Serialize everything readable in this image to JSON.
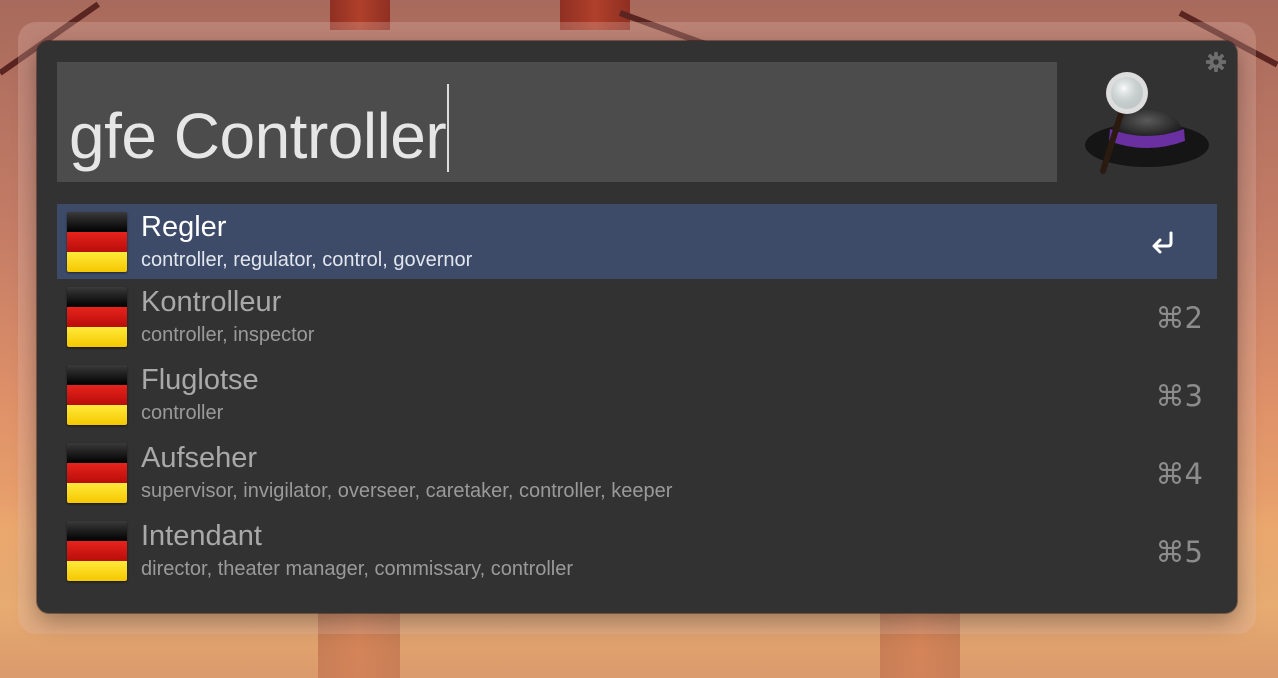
{
  "search": {
    "query": "gfe Controller"
  },
  "results": [
    {
      "title": "Regler",
      "subtitle": "controller, regulator, control, governor",
      "shortcut": "",
      "icon": "german-flag-icon",
      "selected": true
    },
    {
      "title": "Kontrolleur",
      "subtitle": "controller, inspector",
      "shortcut": "⌘2",
      "icon": "german-flag-icon",
      "selected": false
    },
    {
      "title": "Fluglotse",
      "subtitle": "controller",
      "shortcut": "⌘3",
      "icon": "german-flag-icon",
      "selected": false
    },
    {
      "title": "Aufseher",
      "subtitle": "supervisor, invigilator, overseer, caretaker, controller, keeper",
      "shortcut": "⌘4",
      "icon": "german-flag-icon",
      "selected": false
    },
    {
      "title": "Intendant",
      "subtitle": "director, theater manager, commissary, controller",
      "shortcut": "⌘5",
      "icon": "german-flag-icon",
      "selected": false
    }
  ],
  "colors": {
    "window_bg": "#323232",
    "search_bg": "#4c4c4c",
    "selected_row": "#3d4b68",
    "logo_band": "#6a2fa0"
  },
  "icons": {
    "settings": "gear-icon",
    "app_logo": "alfred-hat-icon",
    "return": "return-key-icon"
  }
}
